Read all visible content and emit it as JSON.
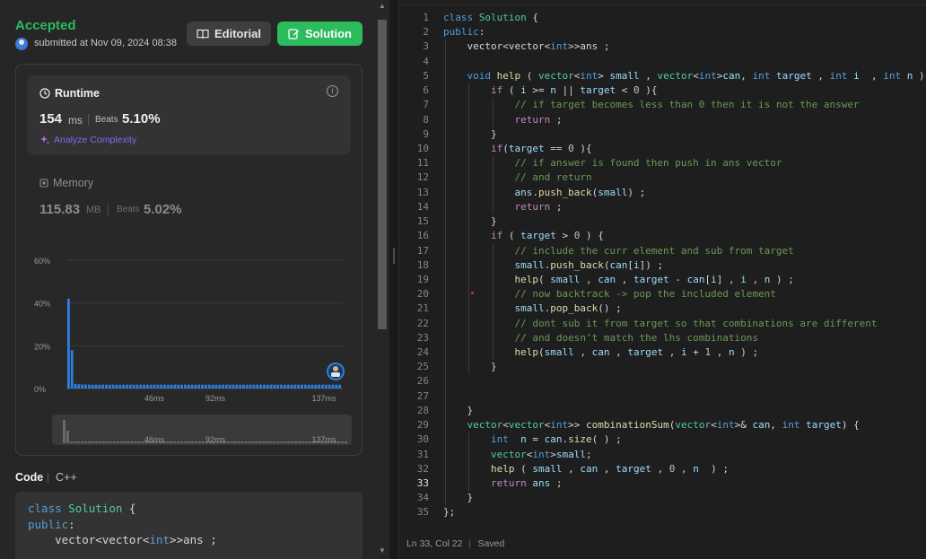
{
  "result": {
    "status": "Accepted",
    "submitted_text": "submitted at Nov 09, 2024 08:38",
    "editorial_label": "Editorial",
    "solution_label": "Solution"
  },
  "runtime": {
    "title": "Runtime",
    "value": "154",
    "unit": "ms",
    "beats_label": "Beats",
    "beats_pct": "5.10%",
    "analyze_label": "Analyze Complexity"
  },
  "memory": {
    "title": "Memory",
    "value": "115.83",
    "unit": "MB",
    "beats_label": "Beats",
    "beats_pct": "5.02%"
  },
  "chart_data": {
    "type": "bar",
    "y_ticks": [
      "60%",
      "40%",
      "20%",
      "0%"
    ],
    "ylim": [
      0,
      60
    ],
    "x_ticks": [
      "46ms",
      "92ms",
      "137ms"
    ],
    "bar_color": "#2e7de1",
    "values": [
      42,
      18,
      2.2,
      2.0,
      1.9,
      1.9,
      1.8,
      1.8,
      1.8,
      1.8,
      1.8,
      1.8,
      1.8,
      1.8,
      1.8,
      1.8,
      1.8,
      1.8,
      1.8,
      1.8,
      1.8,
      1.8,
      1.8,
      1.8,
      1.8,
      1.8,
      1.8,
      1.8,
      1.8,
      1.8,
      1.8,
      1.8,
      1.8,
      1.8,
      1.8,
      1.8,
      1.8,
      1.8,
      1.8,
      1.8,
      1.8,
      1.8,
      1.8,
      1.8,
      1.8,
      1.8,
      1.8,
      1.8,
      1.8,
      1.8,
      1.8,
      1.8,
      1.8,
      1.8,
      1.8,
      1.8,
      1.8,
      1.8,
      1.8,
      1.8,
      1.8,
      1.8,
      1.8,
      1.8,
      1.8,
      1.8,
      1.8,
      1.8,
      1.8,
      1.8,
      1.8,
      1.8,
      1.8,
      1.8,
      1.8,
      1.8,
      1.8,
      1.8,
      1.8,
      1.8
    ]
  },
  "mini_chart": {
    "x_ticks": [
      "46ms",
      "92ms",
      "137ms"
    ]
  },
  "code_section": {
    "label": "Code",
    "language": "C++",
    "preview": [
      [
        [
          "kw",
          "class"
        ],
        [
          "t",
          " "
        ],
        [
          "cl",
          "Solution"
        ],
        [
          "t",
          " {"
        ]
      ],
      [
        [
          "kw",
          "public"
        ],
        [
          "t",
          ":"
        ]
      ],
      [
        [
          "t",
          "    vector<vector<"
        ],
        [
          "kw",
          "int"
        ],
        [
          "t",
          ">>ans ;"
        ]
      ]
    ]
  },
  "editor": {
    "active_line": 33,
    "status_position": "Ln 33, Col 22",
    "status_saved": "Saved",
    "lines": [
      {
        "n": "1",
        "i": 0,
        "t": [
          [
            "kw",
            "class"
          ],
          [
            "t",
            " "
          ],
          [
            "cl",
            "Solution"
          ],
          [
            "t",
            " {"
          ]
        ]
      },
      {
        "n": "2",
        "i": 0,
        "t": [
          [
            "kw",
            "public"
          ],
          [
            "t",
            ":"
          ]
        ]
      },
      {
        "n": "3",
        "i": 1,
        "t": [
          [
            "t",
            "    vector<vector<"
          ],
          [
            "kw",
            "int"
          ],
          [
            "t",
            ">>ans ;"
          ]
        ]
      },
      {
        "n": "4",
        "i": 1,
        "t": []
      },
      {
        "n": "5",
        "i": 1,
        "t": [
          [
            "t",
            "    "
          ],
          [
            "kw",
            "void"
          ],
          [
            "t",
            " "
          ],
          [
            "fn",
            "help"
          ],
          [
            "t",
            " ( "
          ],
          [
            "cl",
            "vector"
          ],
          [
            "t",
            "<"
          ],
          [
            "kw",
            "int"
          ],
          [
            "t",
            "> "
          ],
          [
            "vr",
            "small"
          ],
          [
            "t",
            " , "
          ],
          [
            "cl",
            "vector"
          ],
          [
            "t",
            "<"
          ],
          [
            "kw",
            "int"
          ],
          [
            "t",
            ">"
          ],
          [
            "vr",
            "can"
          ],
          [
            "t",
            ", "
          ],
          [
            "kw",
            "int"
          ],
          [
            "t",
            " "
          ],
          [
            "vr",
            "target"
          ],
          [
            "t",
            " , "
          ],
          [
            "kw",
            "int"
          ],
          [
            "t",
            " "
          ],
          [
            "vr",
            "i"
          ],
          [
            "t",
            "  , "
          ],
          [
            "kw",
            "int"
          ],
          [
            "t",
            " "
          ],
          [
            "vr",
            "n"
          ],
          [
            "t",
            " ) {"
          ]
        ]
      },
      {
        "n": "6",
        "i": 2,
        "t": [
          [
            "t",
            "        "
          ],
          [
            "ct",
            "if"
          ],
          [
            "t",
            " ( "
          ],
          [
            "vr",
            "i"
          ],
          [
            "t",
            " >= "
          ],
          [
            "vr",
            "n"
          ],
          [
            "t",
            " || "
          ],
          [
            "vr",
            "target"
          ],
          [
            "t",
            " < "
          ],
          [
            "nm",
            "0"
          ],
          [
            "t",
            " ){"
          ]
        ]
      },
      {
        "n": "7",
        "i": 3,
        "t": [
          [
            "t",
            "            "
          ],
          [
            "cm",
            "// if target becomes less than 0 then it is not the answer"
          ]
        ]
      },
      {
        "n": "8",
        "i": 3,
        "t": [
          [
            "t",
            "            "
          ],
          [
            "ct",
            "return"
          ],
          [
            "t",
            " ;"
          ]
        ]
      },
      {
        "n": "9",
        "i": 2,
        "t": [
          [
            "t",
            "        }"
          ]
        ]
      },
      {
        "n": "10",
        "i": 2,
        "t": [
          [
            "t",
            "        "
          ],
          [
            "ct",
            "if"
          ],
          [
            "t",
            "("
          ],
          [
            "vr",
            "target"
          ],
          [
            "t",
            " == "
          ],
          [
            "nm",
            "0"
          ],
          [
            "t",
            " ){"
          ]
        ]
      },
      {
        "n": "11",
        "i": 3,
        "t": [
          [
            "t",
            "            "
          ],
          [
            "cm",
            "// if answer is found then push in ans vector"
          ]
        ]
      },
      {
        "n": "12",
        "i": 3,
        "t": [
          [
            "t",
            "            "
          ],
          [
            "cm",
            "// and return"
          ]
        ]
      },
      {
        "n": "13",
        "i": 3,
        "t": [
          [
            "t",
            "            "
          ],
          [
            "vr",
            "ans"
          ],
          [
            "t",
            "."
          ],
          [
            "fn",
            "push_back"
          ],
          [
            "t",
            "("
          ],
          [
            "vr",
            "small"
          ],
          [
            "t",
            ") ;"
          ]
        ]
      },
      {
        "n": "14",
        "i": 3,
        "t": [
          [
            "t",
            "            "
          ],
          [
            "ct",
            "return"
          ],
          [
            "t",
            " ;"
          ]
        ]
      },
      {
        "n": "15",
        "i": 2,
        "t": [
          [
            "t",
            "        }"
          ]
        ]
      },
      {
        "n": "16",
        "i": 2,
        "t": [
          [
            "t",
            "        "
          ],
          [
            "ct",
            "if"
          ],
          [
            "t",
            " ( "
          ],
          [
            "vr",
            "target"
          ],
          [
            "t",
            " > "
          ],
          [
            "nm",
            "0"
          ],
          [
            "t",
            " ) {"
          ]
        ]
      },
      {
        "n": "17",
        "i": 3,
        "t": [
          [
            "t",
            "            "
          ],
          [
            "cm",
            "// include the curr element and sub from target"
          ]
        ]
      },
      {
        "n": "18",
        "i": 3,
        "t": [
          [
            "t",
            "            "
          ],
          [
            "vr",
            "small"
          ],
          [
            "t",
            "."
          ],
          [
            "fn",
            "push_back"
          ],
          [
            "t",
            "("
          ],
          [
            "vr",
            "can"
          ],
          [
            "t",
            "["
          ],
          [
            "vr",
            "i"
          ],
          [
            "t",
            "]) ;"
          ]
        ]
      },
      {
        "n": "19",
        "i": 3,
        "t": [
          [
            "t",
            "            "
          ],
          [
            "fn",
            "help"
          ],
          [
            "t",
            "( "
          ],
          [
            "vr",
            "small"
          ],
          [
            "t",
            " , "
          ],
          [
            "vr",
            "can"
          ],
          [
            "t",
            " , "
          ],
          [
            "vr",
            "target"
          ],
          [
            "t",
            " - "
          ],
          [
            "vr",
            "can"
          ],
          [
            "t",
            "["
          ],
          [
            "vr",
            "i"
          ],
          [
            "t",
            "] , "
          ],
          [
            "vr",
            "i"
          ],
          [
            "t",
            " , "
          ],
          [
            "vr",
            "n"
          ],
          [
            "t",
            " ) ;"
          ]
        ]
      },
      {
        "n": "20",
        "i": 3,
        "t": [
          [
            "t",
            "            "
          ],
          [
            "cm",
            "// now backtrack -> pop the included element"
          ]
        ]
      },
      {
        "n": "21",
        "i": 3,
        "t": [
          [
            "t",
            "            "
          ],
          [
            "vr",
            "small"
          ],
          [
            "t",
            "."
          ],
          [
            "fn",
            "pop_back"
          ],
          [
            "t",
            "() ;"
          ]
        ]
      },
      {
        "n": "22",
        "i": 3,
        "t": [
          [
            "t",
            "            "
          ],
          [
            "cm",
            "// dont sub it from target so that combinations are different"
          ]
        ]
      },
      {
        "n": "23",
        "i": 3,
        "t": [
          [
            "t",
            "            "
          ],
          [
            "cm",
            "// and doesn't match the lhs combinations"
          ]
        ]
      },
      {
        "n": "24",
        "i": 3,
        "t": [
          [
            "t",
            "            "
          ],
          [
            "fn",
            "help"
          ],
          [
            "t",
            "("
          ],
          [
            "vr",
            "small"
          ],
          [
            "t",
            " , "
          ],
          [
            "vr",
            "can"
          ],
          [
            "t",
            " , "
          ],
          [
            "vr",
            "target"
          ],
          [
            "t",
            " , "
          ],
          [
            "vr",
            "i"
          ],
          [
            "t",
            " + "
          ],
          [
            "nm",
            "1"
          ],
          [
            "t",
            " , "
          ],
          [
            "vr",
            "n"
          ],
          [
            "t",
            " ) ;"
          ]
        ]
      },
      {
        "n": "25",
        "i": 2,
        "t": [
          [
            "t",
            "        }"
          ]
        ]
      },
      {
        "n": "26",
        "i": 1,
        "t": []
      },
      {
        "n": "27",
        "i": 1,
        "t": []
      },
      {
        "n": "28",
        "i": 1,
        "t": [
          [
            "t",
            "    }"
          ]
        ]
      },
      {
        "n": "29",
        "i": 1,
        "t": [
          [
            "t",
            "    "
          ],
          [
            "cl",
            "vector"
          ],
          [
            "t",
            "<"
          ],
          [
            "cl",
            "vector"
          ],
          [
            "t",
            "<"
          ],
          [
            "kw",
            "int"
          ],
          [
            "t",
            ">> "
          ],
          [
            "fn",
            "combinationSum"
          ],
          [
            "t",
            "("
          ],
          [
            "cl",
            "vector"
          ],
          [
            "t",
            "<"
          ],
          [
            "kw",
            "int"
          ],
          [
            "t",
            ">& "
          ],
          [
            "vr",
            "can"
          ],
          [
            "t",
            ", "
          ],
          [
            "kw",
            "int"
          ],
          [
            "t",
            " "
          ],
          [
            "vr",
            "target"
          ],
          [
            "t",
            ") {"
          ]
        ]
      },
      {
        "n": "30",
        "i": 2,
        "t": [
          [
            "t",
            "        "
          ],
          [
            "kw",
            "int"
          ],
          [
            "t",
            "  "
          ],
          [
            "vr",
            "n"
          ],
          [
            "t",
            " = "
          ],
          [
            "vr",
            "can"
          ],
          [
            "t",
            "."
          ],
          [
            "fn",
            "size"
          ],
          [
            "t",
            "( ) ;"
          ]
        ]
      },
      {
        "n": "31",
        "i": 2,
        "t": [
          [
            "t",
            "        "
          ],
          [
            "cl",
            "vector"
          ],
          [
            "t",
            "<"
          ],
          [
            "kw",
            "int"
          ],
          [
            "t",
            ">"
          ],
          [
            "vr",
            "small"
          ],
          [
            "t",
            ";"
          ]
        ]
      },
      {
        "n": "32",
        "i": 2,
        "t": [
          [
            "t",
            "        "
          ],
          [
            "fn",
            "help"
          ],
          [
            "t",
            " ( "
          ],
          [
            "vr",
            "small"
          ],
          [
            "t",
            " , "
          ],
          [
            "vr",
            "can"
          ],
          [
            "t",
            " , "
          ],
          [
            "vr",
            "target"
          ],
          [
            "t",
            " , "
          ],
          [
            "nm",
            "0"
          ],
          [
            "t",
            " , "
          ],
          [
            "vr",
            "n"
          ],
          [
            "t",
            "  ) ;"
          ]
        ]
      },
      {
        "n": "33",
        "i": 2,
        "t": [
          [
            "t",
            "        "
          ],
          [
            "ct",
            "return"
          ],
          [
            "t",
            " "
          ],
          [
            "vr",
            "ans"
          ],
          [
            "t",
            " ;"
          ]
        ]
      },
      {
        "n": "34",
        "i": 1,
        "t": [
          [
            "t",
            "    }"
          ]
        ]
      },
      {
        "n": "35",
        "i": 0,
        "t": [
          [
            "t",
            "};"
          ]
        ]
      }
    ]
  }
}
